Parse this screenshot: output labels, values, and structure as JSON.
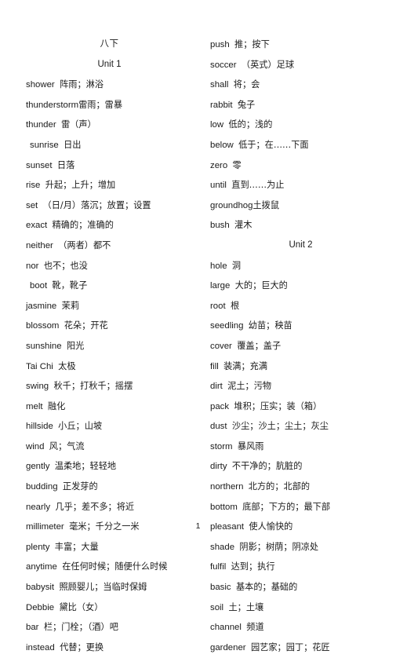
{
  "document": {
    "book_title": "八下",
    "page_number": "1"
  },
  "left_column": {
    "heading": "Unit 1",
    "entries": [
      {
        "term": "shower",
        "gloss": "阵雨；淋浴",
        "indent": false
      },
      {
        "term": "thunderstorm",
        "gloss": "雷雨；雷暴",
        "indent": false,
        "nospace": true
      },
      {
        "term": "thunder",
        "gloss": "雷（声）",
        "indent": false
      },
      {
        "term": "sunrise",
        "gloss": "日出",
        "indent": true
      },
      {
        "term": "sunset",
        "gloss": "日落",
        "indent": false
      },
      {
        "term": "rise",
        "gloss": "升起；上升；增加",
        "indent": false
      },
      {
        "term": "set",
        "gloss": "（日/月）落沉；放置；设置",
        "indent": false
      },
      {
        "term": "exact",
        "gloss": "精确的；准确的",
        "indent": false
      },
      {
        "term": "neither",
        "gloss": "（两者）都不",
        "indent": false
      },
      {
        "term": "nor",
        "gloss": "也不；也没",
        "indent": false
      },
      {
        "term": "boot",
        "gloss": "靴，靴子",
        "indent": true
      },
      {
        "term": "jasmine",
        "gloss": "茉莉",
        "indent": false
      },
      {
        "term": "blossom",
        "gloss": "花朵；开花",
        "indent": false
      },
      {
        "term": "sunshine",
        "gloss": "阳光",
        "indent": false
      },
      {
        "term": "Tai Chi",
        "gloss": "太极",
        "indent": false
      },
      {
        "term": "swing",
        "gloss": "秋千；打秋千；摇摆",
        "indent": false
      },
      {
        "term": "melt",
        "gloss": "融化",
        "indent": false
      },
      {
        "term": "hillside",
        "gloss": "小丘；山坡",
        "indent": false
      },
      {
        "term": "wind",
        "gloss": "风；气流",
        "indent": false
      },
      {
        "term": "gently",
        "gloss": "温柔地；轻轻地",
        "indent": false
      },
      {
        "term": "budding",
        "gloss": "正发芽的",
        "indent": false
      },
      {
        "term": "nearly",
        "gloss": "几乎；差不多；将近",
        "indent": false
      },
      {
        "term": "millimeter",
        "gloss": "毫米；千分之一米",
        "indent": false
      },
      {
        "term": "plenty",
        "gloss": "丰富；大量",
        "indent": false
      },
      {
        "term": "anytime",
        "gloss": "在任何时候；随便什么时候",
        "indent": false
      },
      {
        "term": "babysit",
        "gloss": "照顾婴儿；当临时保姆",
        "indent": false
      },
      {
        "term": "Debbie",
        "gloss": "黛比（女）",
        "indent": false
      },
      {
        "term": "bar",
        "gloss": "栏；门栓；（酒）吧",
        "indent": false
      },
      {
        "term": "instead",
        "gloss": "代替；更换",
        "indent": false
      }
    ]
  },
  "right_column": {
    "heading": "Unit 2",
    "heading_after_index": 11,
    "entries": [
      {
        "term": "push",
        "gloss": "推；按下",
        "indent": false
      },
      {
        "term": "soccer",
        "gloss": "（英式）足球",
        "indent": false
      },
      {
        "term": "shall",
        "gloss": "将；会",
        "indent": false
      },
      {
        "term": "rabbit",
        "gloss": "兔子",
        "indent": false
      },
      {
        "term": "low",
        "gloss": "低的；浅的",
        "indent": false
      },
      {
        "term": "below",
        "gloss": "低于；在……下面",
        "indent": false
      },
      {
        "term": "zero",
        "gloss": "零",
        "indent": false
      },
      {
        "term": "until",
        "gloss": "直到……为止",
        "indent": false
      },
      {
        "term": "groundhog",
        "gloss": "土拨鼠",
        "indent": false,
        "nospace": true
      },
      {
        "term": "bush",
        "gloss": "灌木",
        "indent": false
      },
      {
        "term": "hole",
        "gloss": "洞",
        "indent": false
      },
      {
        "term": "large",
        "gloss": "大的；巨大的",
        "indent": false
      },
      {
        "term": "root",
        "gloss": "根",
        "indent": false
      },
      {
        "term": "seedling",
        "gloss": "幼苗；秧苗",
        "indent": false
      },
      {
        "term": "cover",
        "gloss": "覆盖；盖子",
        "indent": false
      },
      {
        "term": "fill",
        "gloss": "装满；充满",
        "indent": false
      },
      {
        "term": "dirt",
        "gloss": "泥土；污物",
        "indent": false
      },
      {
        "term": "pack",
        "gloss": "堆积；压实；装（箱）",
        "indent": false
      },
      {
        "term": "dust",
        "gloss": "沙尘；沙土；尘土；灰尘",
        "indent": false
      },
      {
        "term": "storm",
        "gloss": "暴风雨",
        "indent": false
      },
      {
        "term": "dirty",
        "gloss": "不干净的；肮脏的",
        "indent": false
      },
      {
        "term": "northern",
        "gloss": "北方的；北部的",
        "indent": false
      },
      {
        "term": "bottom",
        "gloss": "底部；下方的；最下部",
        "indent": false
      },
      {
        "term": "pleasant",
        "gloss": "使人愉快的",
        "indent": false
      },
      {
        "term": "shade",
        "gloss": "阴影；树荫；阴凉处",
        "indent": false
      },
      {
        "term": "fulfil",
        "gloss": "达到；执行",
        "indent": false
      },
      {
        "term": "basic",
        "gloss": "基本的；基础的",
        "indent": false
      },
      {
        "term": "soil",
        "gloss": "土；土壤",
        "indent": false
      },
      {
        "term": "channel",
        "gloss": "频道",
        "indent": false
      },
      {
        "term": "gardener",
        "gloss": "园艺家；园丁；花匠",
        "indent": false
      }
    ]
  }
}
